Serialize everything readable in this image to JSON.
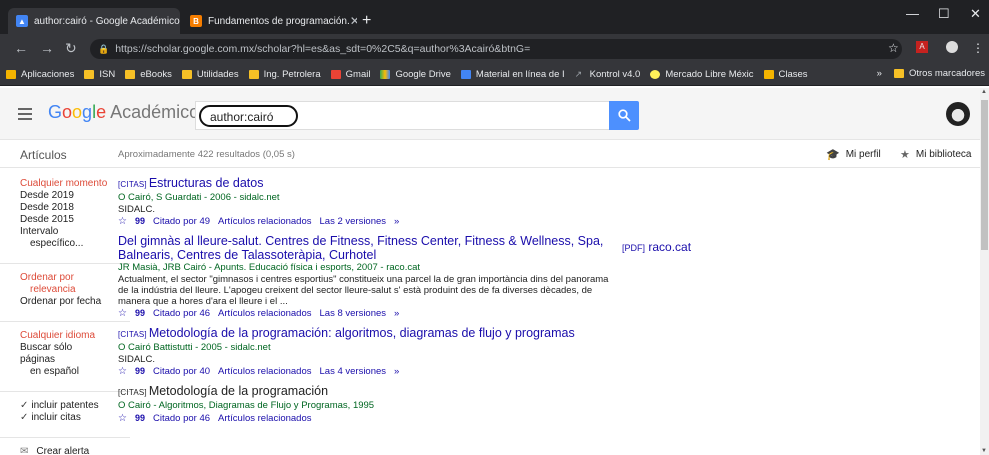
{
  "tabs": [
    {
      "title": "author:cairó - Google Académico",
      "favicon": "scholar-icon",
      "active": true
    },
    {
      "title": "Fundamentos de programación.",
      "favicon": "blogger-icon",
      "active": false
    }
  ],
  "window": {
    "minimize": "—",
    "maximize": "☐",
    "close": "✕",
    "new_tab": "+"
  },
  "toolbar": {
    "url": "https://scholar.google.com.mx/scholar?hl=es&as_sdt=0%2C5&q=author%3Acairó&btnG="
  },
  "bookmarks": {
    "items": [
      {
        "label": "Aplicaciones",
        "icon": "apps-grid-icon",
        "color": "#f4b400"
      },
      {
        "label": "ISN",
        "icon": "folder-icon",
        "color": "#f6c026"
      },
      {
        "label": "eBooks",
        "icon": "folder-icon",
        "color": "#f6c026"
      },
      {
        "label": "Utilidades",
        "icon": "folder-icon",
        "color": "#f6c026"
      },
      {
        "label": "Ing. Petrolera",
        "icon": "folder-icon",
        "color": "#f6c026"
      },
      {
        "label": "Gmail",
        "icon": "gmail-icon",
        "color": "#ea4335"
      },
      {
        "label": "Google Drive",
        "icon": "drive-icon",
        "color": "#34a853"
      },
      {
        "label": "Material en línea de I",
        "icon": "document-icon",
        "color": "#4285f4"
      },
      {
        "label": "Kontrol v4.0",
        "icon": "arrow-icon",
        "color": "#9aa0a6"
      },
      {
        "label": "Mercado Libre Méxic",
        "icon": "mercadolibre-icon",
        "color": "#fff159"
      },
      {
        "label": "Clases",
        "icon": "classroom-icon",
        "color": "#f4b400"
      }
    ],
    "more": "»",
    "other": "Otros marcadores"
  },
  "header": {
    "logo_google": [
      "G",
      "o",
      "o",
      "g",
      "l",
      "e"
    ],
    "logo_academico": "Académico",
    "query": "author:cairó"
  },
  "subheader": {
    "section": "Artículos",
    "result_count": "Aproximadamente 422 resultados (0,05 s)",
    "profile": "Mi perfil",
    "library": "Mi biblioteca"
  },
  "sidebar": {
    "time": [
      "Cualquier momento",
      "Desde 2019",
      "Desde 2018",
      "Desde 2015",
      "Intervalo",
      "específico..."
    ],
    "sort": [
      "Ordenar por",
      "relevancia",
      "Ordenar por fecha"
    ],
    "language": [
      "Cualquier idioma",
      "Buscar sólo páginas",
      "en español"
    ],
    "checks": [
      "incluir patentes",
      "incluir citas"
    ],
    "alert": "Crear alerta"
  },
  "results": [
    {
      "tag": "[CITAS]",
      "title": "Estructuras de datos",
      "authors": "O Cairó, S Guardati - 2006 - sidalc.net",
      "snippet": "SIDALC.",
      "cited": "Citado por 49",
      "related": "Artículos relacionados",
      "versions": "Las 2 versiones"
    },
    {
      "tag": "",
      "title": "Del gimnàs al lleure-salut. Centres de Fitness, Fitness Center, Fitness & Wellness, Spa, Balnearis, Centres de Talassoteràpia, Curhotel",
      "authors": "JR Masià, JRB Cairó - Apunts. Educació física i esports, 2007 - raco.cat",
      "snippet": "Actualment, el sector \"gimnasos i centres esportius\" constitueix una parcel la de gran importància dins del panorama de la indústria del lleure. L'apogeu creixent del sector lleure-salut s' està produint des de fa diverses dècades, de manera que a hores d'ara el lleure i el ...",
      "cited": "Citado por 46",
      "related": "Artículos relacionados",
      "versions": "Las 8 versiones"
    },
    {
      "tag": "[CITAS]",
      "title": "Metodología de la programación: algoritmos, diagramas de flujo y programas",
      "authors": "O Cairó Battistutti - 2005 - sidalc.net",
      "snippet": "SIDALC.",
      "cited": "Citado por 40",
      "related": "Artículos relacionados",
      "versions": "Las 4 versiones"
    },
    {
      "tag": "[CITAS]",
      "title": "Metodología de la programación",
      "authors": "O Cairó - Algoritmos, Diagramas de Flujo y Programas, 1995",
      "cited": "Citado por 46",
      "related": "Artículos relacionados"
    }
  ],
  "side_link": {
    "tag": "[PDF]",
    "label": "raco.cat"
  },
  "colors": {
    "link": "#1a0dab",
    "author_green": "#006621",
    "accent_red": "#dd4b39",
    "search_blue": "#4d90fe"
  }
}
